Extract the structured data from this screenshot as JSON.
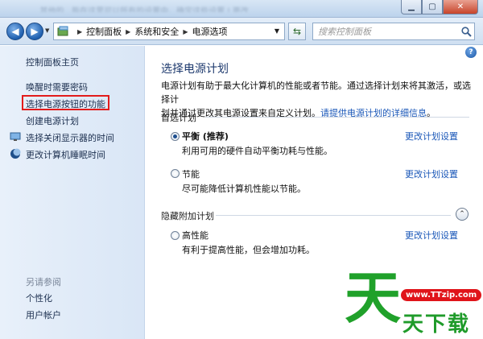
{
  "titlebar": {
    "blurred_text": "...其他的...能在这里可以所有的设置中，确定这些设置 | 更改...",
    "buttons": [
      "minimize",
      "maximize",
      "close"
    ]
  },
  "navbar": {
    "breadcrumb": [
      "控制面板",
      "系统和安全",
      "电源选项"
    ],
    "search_placeholder": "搜索控制面板"
  },
  "sidebar": {
    "home": "控制面板主页",
    "links": [
      "唤醒时需要密码",
      "选择电源按钮的功能",
      "创建电源计划",
      "选择关闭显示器的时间",
      "更改计算机睡眠时间"
    ],
    "see_also_label": "另请参阅",
    "see_also_links": [
      "个性化",
      "用户帐户"
    ]
  },
  "main": {
    "title": "选择电源计划",
    "desc_line1": "电源计划有助于最大化计算机的性能或者节能。通过选择计划来将其激活，或选择计",
    "desc_line2_prefix": "划并通过更改其电源设置来自定义计划。",
    "desc_link": "请提供电源计划的详细信息",
    "desc_suffix": "。",
    "preferred_label": "首选计划",
    "hidden_label": "隐藏附加计划",
    "plans": [
      {
        "name": "平衡 (推荐)",
        "desc": "利用可用的硬件自动平衡功耗与性能。",
        "link": "更改计划设置",
        "selected": true
      },
      {
        "name": "节能",
        "desc": "尽可能降低计算机性能以节能。",
        "link": "更改计划设置",
        "selected": false
      },
      {
        "name": "高性能",
        "desc": "有利于提高性能，但会增加功耗。",
        "link": "更改计划设置",
        "selected": false
      }
    ]
  },
  "watermark": {
    "big": "天",
    "url": "www.TTzip.com",
    "small": "天下载"
  }
}
